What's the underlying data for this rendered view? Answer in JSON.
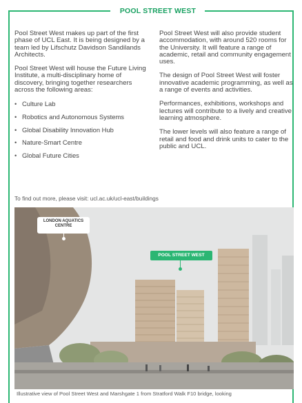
{
  "section": {
    "title": "POOL STREET WEST"
  },
  "left_column": {
    "paragraphs": [
      "Pool Street West makes up part of the first phase of UCL East. It is being designed by a team led by Lifschutz Davidson Sandilands Architects.",
      "Pool Street West will house the Future Living Institute, a multi-disciplinary home of discovery, bringing together researchers across the following areas:"
    ],
    "bullets": [
      "Culture Lab",
      "Robotics and Autonomous Systems",
      "Global Disability Innovation Hub",
      "Nature-Smart Centre",
      "Global Future Cities"
    ]
  },
  "right_column": {
    "paragraphs": [
      "Pool Street West will also provide student accommodation, with around 520 rooms for the University. It will feature a range of academic, retail and community engagement uses.",
      "The design of Pool Street West will foster innovative academic programming, as well as a range of events and activities.",
      "Performances, exhibitions, workshops and lectures will contribute to a lively and creative learning atmosphere.",
      "The lower levels will also feature a range of retail and food and drink units to cater to the public and UCL."
    ]
  },
  "more_info": "To find out more, please visit: ucl.ac.uk/ucl-east/buildings",
  "image": {
    "labels": {
      "aquatics": "LONDON AQUATICS CENTRE",
      "pool_street": "POOL STREET WEST"
    },
    "caption": "Illustrative view of Pool Street West and Marshgate 1 from Stratford Walk F10 bridge, looking"
  },
  "colors": {
    "accent": "#2bb673",
    "text": "#444444"
  }
}
